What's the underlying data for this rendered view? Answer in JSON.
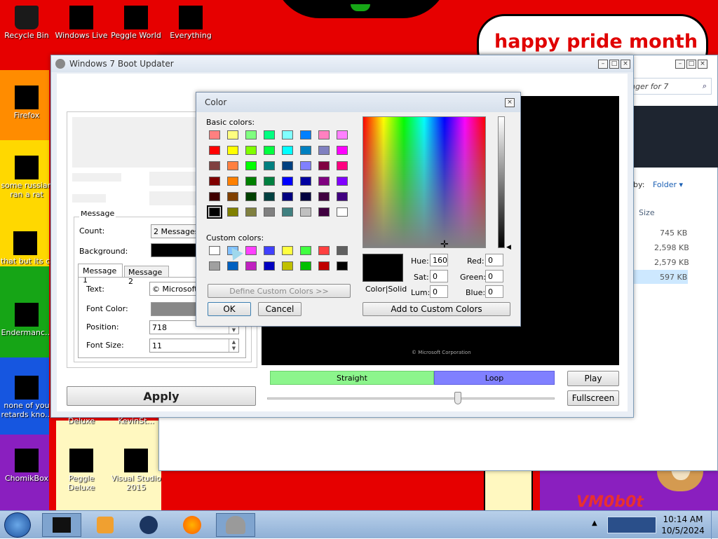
{
  "wallpaper_text": "happy pride month",
  "wallpaper_signature": "VM0b0t",
  "desktop_icons": [
    {
      "label": "Recycle Bin"
    },
    {
      "label": "Windows Live"
    },
    {
      "label": "Peggle World"
    },
    {
      "label": "Everything"
    },
    {
      "label": "Firefox"
    },
    {
      "label": "some russian ran a rat"
    },
    {
      "label": "that but its c"
    },
    {
      "label": "Endermanc..."
    },
    {
      "label": "none of you retards kno..."
    },
    {
      "label": "Deluxe"
    },
    {
      "label": "KevinSt..."
    },
    {
      "label": "ChomikBox"
    },
    {
      "label": "Peggle Deluxe"
    },
    {
      "label": "Visual Studio 2015"
    }
  ],
  "explorer": {
    "search_text": "nger for 7",
    "view_by_label": "by:",
    "view_by_value": "Folder",
    "size_header": "Size",
    "sizes": [
      "745 KB",
      "2,598 KB",
      "2,579 KB",
      "597 KB"
    ]
  },
  "updater": {
    "title": "Windows 7 Boot Updater",
    "group_label": "Message",
    "count_label": "Count:",
    "count_value": "2 Messages",
    "background_label": "Background:",
    "tabs": [
      "Message 1",
      "Message 2"
    ],
    "text_label": "Text:",
    "text_value": "© Microsoft C",
    "font_color_label": "Font Color:",
    "position_label": "Position:",
    "position_value": "718",
    "font_size_label": "Font Size:",
    "font_size_value": "11",
    "apply_label": "Apply",
    "preview_copyright": "© Microsoft Corporation",
    "straight_label": "Straight",
    "loop_label": "Loop",
    "play_label": "Play",
    "fullscreen_label": "Fullscreen",
    "straight_color": "#8cf58c",
    "loop_color": "#8080ff"
  },
  "color_dialog": {
    "title": "Color",
    "basic_colors_label": "Basic colors:",
    "custom_colors_label": "Custom colors:",
    "define_label": "Define Custom Colors >>",
    "ok_label": "OK",
    "cancel_label": "Cancel",
    "add_label": "Add to Custom Colors",
    "color_solid_label": "Color|Solid",
    "hue_label": "Hue:",
    "hue_value": "160",
    "sat_label": "Sat:",
    "sat_value": "0",
    "lum_label": "Lum:",
    "lum_value": "0",
    "red_label": "Red:",
    "red_value": "0",
    "green_label": "Green:",
    "green_value": "0",
    "blue_label": "Blue:",
    "blue_value": "0",
    "basic_colors": [
      "#ff8080",
      "#ffff80",
      "#80ff80",
      "#00ff80",
      "#80ffff",
      "#0080ff",
      "#ff80c0",
      "#ff80ff",
      "#ff0000",
      "#ffff00",
      "#80ff00",
      "#00ff40",
      "#00ffff",
      "#0080c0",
      "#8080c0",
      "#ff00ff",
      "#804040",
      "#ff8040",
      "#00ff00",
      "#008080",
      "#004080",
      "#8080ff",
      "#800040",
      "#ff0080",
      "#800000",
      "#ff8000",
      "#008000",
      "#008040",
      "#0000ff",
      "#0000a0",
      "#800080",
      "#8000ff",
      "#400000",
      "#804000",
      "#004000",
      "#004040",
      "#000080",
      "#000040",
      "#400040",
      "#400080",
      "#000000",
      "#808000",
      "#808040",
      "#808080",
      "#408080",
      "#c0c0c0",
      "#400040",
      "#ffffff"
    ],
    "custom_colors": [
      "#ffffff",
      "#80c0ff",
      "#ff40ff",
      "#4040ff",
      "#ffff40",
      "#40ff40",
      "#ff4040",
      "#606060",
      "#a0a0a0",
      "#0060c0",
      "#c020c0",
      "#0000c0",
      "#c0c000",
      "#00c000",
      "#c00000",
      "#000000"
    ]
  },
  "taskbar": {
    "time": "10:14 AM",
    "date": "10/5/2024"
  }
}
